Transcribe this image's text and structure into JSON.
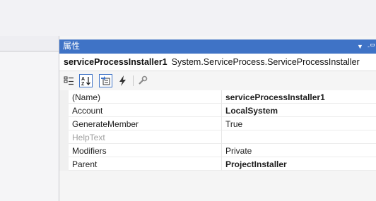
{
  "panel": {
    "title": "属性",
    "pin_label": "▼",
    "dock_label": "-ᄆ"
  },
  "object": {
    "name": "serviceProcessInstaller1",
    "type": "System.ServiceProcess.ServiceProcessInstaller"
  },
  "toolbar": {
    "icons": [
      "categorized-icon",
      "alphabetical-icon",
      "properties-icon",
      "events-icon",
      "property-pages-icon"
    ],
    "accent": "#3f73c6"
  },
  "properties": [
    {
      "name": "(Name)",
      "value": "serviceProcessInstaller1",
      "bold": true,
      "disabled": false
    },
    {
      "name": "Account",
      "value": "LocalSystem",
      "bold": true,
      "disabled": false
    },
    {
      "name": "GenerateMember",
      "value": "True",
      "bold": false,
      "disabled": false
    },
    {
      "name": "HelpText",
      "value": "",
      "bold": false,
      "disabled": true
    },
    {
      "name": "Modifiers",
      "value": "Private",
      "bold": false,
      "disabled": false
    },
    {
      "name": "Parent",
      "value": "ProjectInstaller",
      "bold": true,
      "disabled": false
    }
  ]
}
